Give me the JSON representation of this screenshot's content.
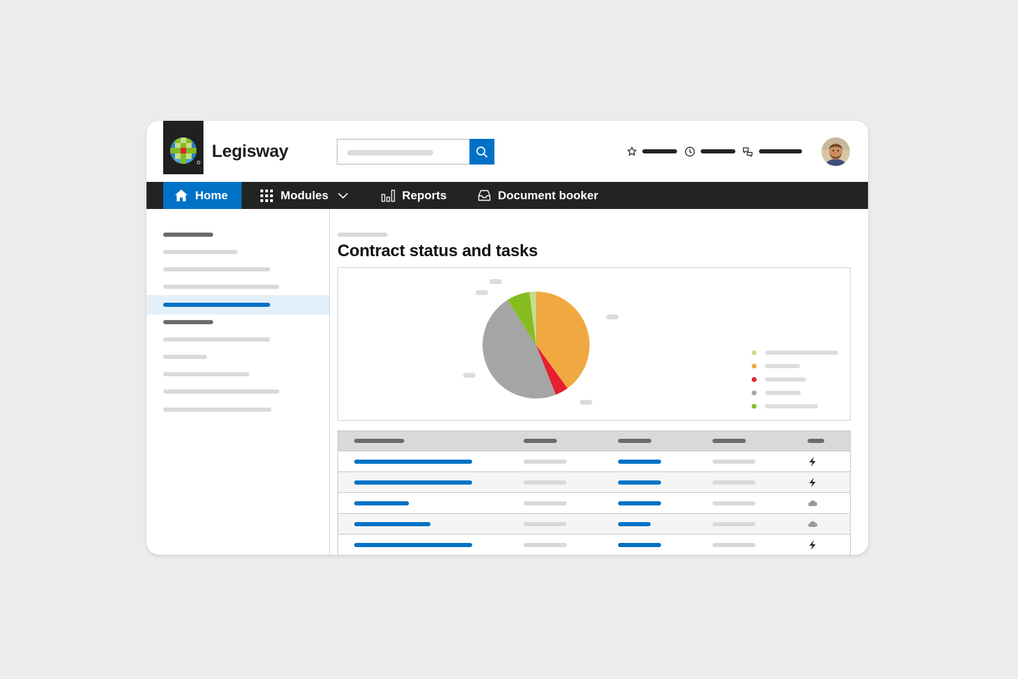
{
  "app": {
    "name": "Legisway",
    "logo_icon": "wolters-kluwer-logo-icon"
  },
  "header": {
    "search": {
      "placeholder": "",
      "icon": "search-icon"
    },
    "links": [
      {
        "icon": "star-icon"
      },
      {
        "icon": "clock-icon"
      },
      {
        "icon": "chat-icon"
      }
    ],
    "avatar": "user-avatar"
  },
  "nav": {
    "items": [
      {
        "label": "Home",
        "icon": "home-icon",
        "active": true
      },
      {
        "label": "Modules",
        "icon": "grid-icon",
        "dropdown": true
      },
      {
        "label": "Reports",
        "icon": "bar-chart-icon"
      },
      {
        "label": "Document booker",
        "icon": "inbox-icon"
      }
    ],
    "active_color": "#0072c6"
  },
  "sidebar": {
    "selected_index": 4
  },
  "main": {
    "title": "Contract status and tasks"
  },
  "chart_data": {
    "type": "pie",
    "values": [
      40,
      4,
      47,
      7,
      2
    ],
    "colors": [
      "#f0a941",
      "#e5202e",
      "#a5a5a5",
      "#85bc20",
      "#c5dd8f"
    ],
    "legend_colors": [
      "#c5dd8f",
      "#f0a941",
      "#e5202e",
      "#a5a5a5",
      "#85bc20"
    ],
    "legend_position": "right",
    "title": ""
  },
  "table": {
    "row_icons": [
      "bolt-icon",
      "bolt-icon",
      "cloud-icon",
      "cloud-icon",
      "bolt-icon"
    ]
  },
  "colors": {
    "brand_blue": "#0072c6",
    "nav_bg": "#232323",
    "selected_bg": "#e3f0fa"
  }
}
